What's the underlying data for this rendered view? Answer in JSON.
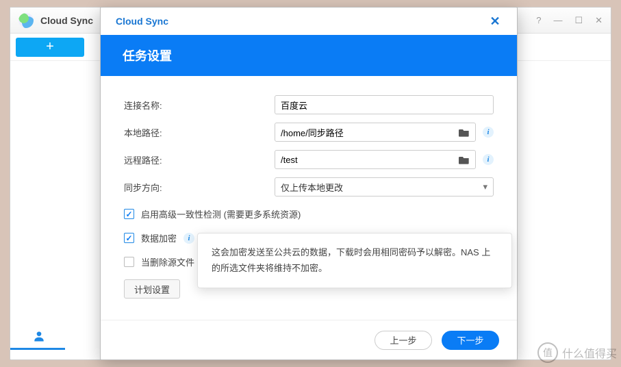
{
  "app": {
    "title": "Cloud Sync"
  },
  "window_controls": {
    "help": "?",
    "min": "—",
    "max": "☐",
    "close": "✕"
  },
  "toolbar": {
    "add": "+"
  },
  "modal": {
    "title": "Cloud Sync",
    "banner": "任务设置",
    "labels": {
      "connection_name": "连接名称:",
      "local_path": "本地路径:",
      "remote_path": "远程路径:",
      "sync_direction": "同步方向:"
    },
    "values": {
      "connection_name": "百度云",
      "local_path": "/home/同步路径",
      "remote_path": "/test",
      "sync_direction": "仅上传本地更改"
    },
    "checks": {
      "consistency": "启用高级一致性检测 (需要更多系统资源)",
      "encryption": "数据加密",
      "delete_source": "当删除源文件"
    },
    "plan_button": "计划设置",
    "footer": {
      "prev": "上一步",
      "next": "下一步"
    }
  },
  "tooltip": {
    "text": "这会加密发送至公共云的数据，下载时会用相同密码予以解密。NAS 上的所选文件夹将维持不加密。"
  },
  "watermark": {
    "char": "值",
    "text": "什么值得买"
  }
}
